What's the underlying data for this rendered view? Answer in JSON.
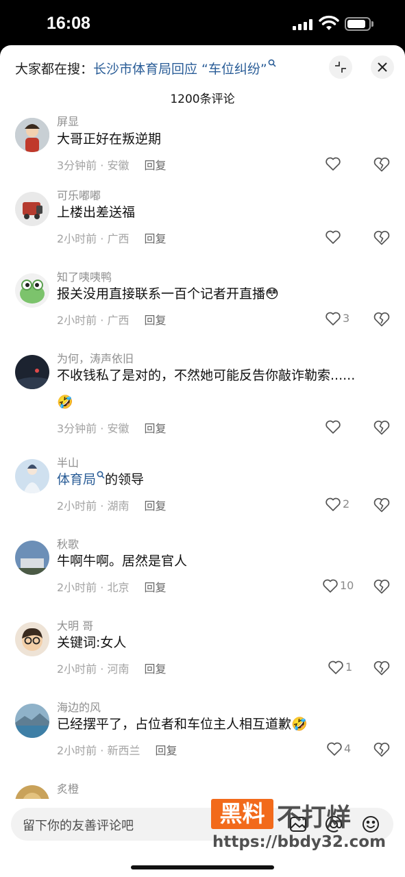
{
  "status_bar": {
    "time": "16:08"
  },
  "header": {
    "search_prefix": "大家都在搜：",
    "search_topic": "长沙市体育局回应 “车位纠纷”",
    "comment_count": "1200条评论"
  },
  "comments": [
    {
      "user": "屏显",
      "text": "大哥正好在叛逆期",
      "time": "3分钟前",
      "region": "安徽",
      "likes": ""
    },
    {
      "user": "可乐嘟嘟",
      "text": "上楼出差送福",
      "time": "2小时前",
      "region": "广西",
      "likes": ""
    },
    {
      "user": "知了咦咦鸭",
      "text": "报关没用直接联系一百个记者开直播",
      "emoji": "😳",
      "time": "2小时前",
      "region": "广西",
      "likes": "3"
    },
    {
      "user": "为何，涛声依旧",
      "text": "不收钱私了是对的，不然她可能反告你敲诈勒索......",
      "emoji": "🤣",
      "time": "3分钟前",
      "region": "安徽",
      "likes": ""
    },
    {
      "user": "半山",
      "topic": "体育局",
      "text": "的领导",
      "time": "2小时前",
      "region": "湖南",
      "likes": "2"
    },
    {
      "user": "秋歌",
      "text": "牛啊牛啊。居然是官人",
      "time": "2小时前",
      "region": "北京",
      "likes": "10"
    },
    {
      "user": "大明 哥",
      "text": "关键词:女人",
      "time": "2小时前",
      "region": "河南",
      "likes": "1"
    },
    {
      "user": "海边的风",
      "text": "已经摆平了，占位者和车位主人相互道歉",
      "emoji": "🤣",
      "time": "2小时前",
      "region": "新西兰",
      "likes": "4"
    },
    {
      "user": "炙橙"
    }
  ],
  "labels": {
    "reply": "回复",
    "separator": " · "
  },
  "input": {
    "placeholder": "留下你的友善评论吧"
  },
  "watermark": {
    "brand": "黑料",
    "text": "不打烊",
    "url": "https://bbdy32.com"
  },
  "colors": {
    "topic_link": "#2a5d97",
    "watermark_orange": "#f26a1b"
  },
  "icons": [
    "cellular-signal-icon",
    "wifi-icon",
    "battery-icon",
    "search-icon",
    "collapse-icon",
    "close-icon",
    "heart-icon",
    "broken-heart-icon",
    "image-icon",
    "at-icon",
    "smile-icon"
  ]
}
